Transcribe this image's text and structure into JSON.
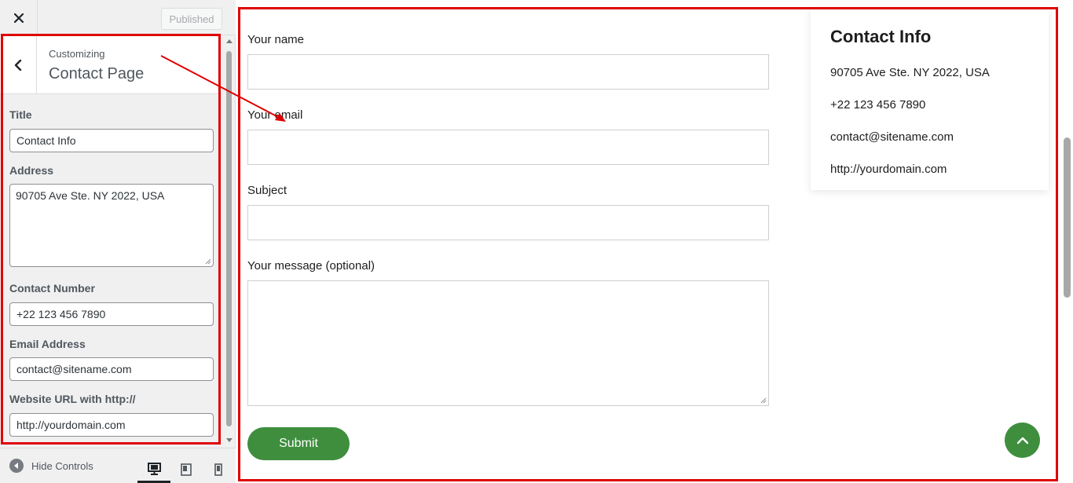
{
  "topbar": {
    "close_icon": "close-icon",
    "publish_label": "Published"
  },
  "section": {
    "crumb": "Customizing",
    "title": "Contact Page"
  },
  "controls": {
    "title_label": "Title",
    "title_value": "Contact Info",
    "address_label": "Address",
    "address_value": "90705 Ave Ste. NY 2022, USA",
    "phone_label": "Contact Number",
    "phone_value": "+22 123 456 7890",
    "email_label": "Email Address",
    "email_value": "contact@sitename.com",
    "url_label": "Website URL with http://",
    "url_value": "http://yourdomain.com"
  },
  "footer": {
    "hide_label": "Hide Controls",
    "devices": [
      "desktop-icon",
      "tablet-icon",
      "mobile-icon"
    ],
    "active_device": "desktop"
  },
  "form": {
    "name_label": "Your name",
    "email_label": "Your email",
    "subject_label": "Subject",
    "message_label": "Your message (optional)",
    "submit_label": "Submit"
  },
  "info": {
    "title": "Contact Info",
    "address": "90705 Ave Ste. NY 2022, USA",
    "phone": "+22 123 456 7890",
    "email": "contact@sitename.com",
    "website": "http://yourdomain.com"
  },
  "colors": {
    "accent_green": "#3e8e3e",
    "annotation_red": "#e00000"
  }
}
